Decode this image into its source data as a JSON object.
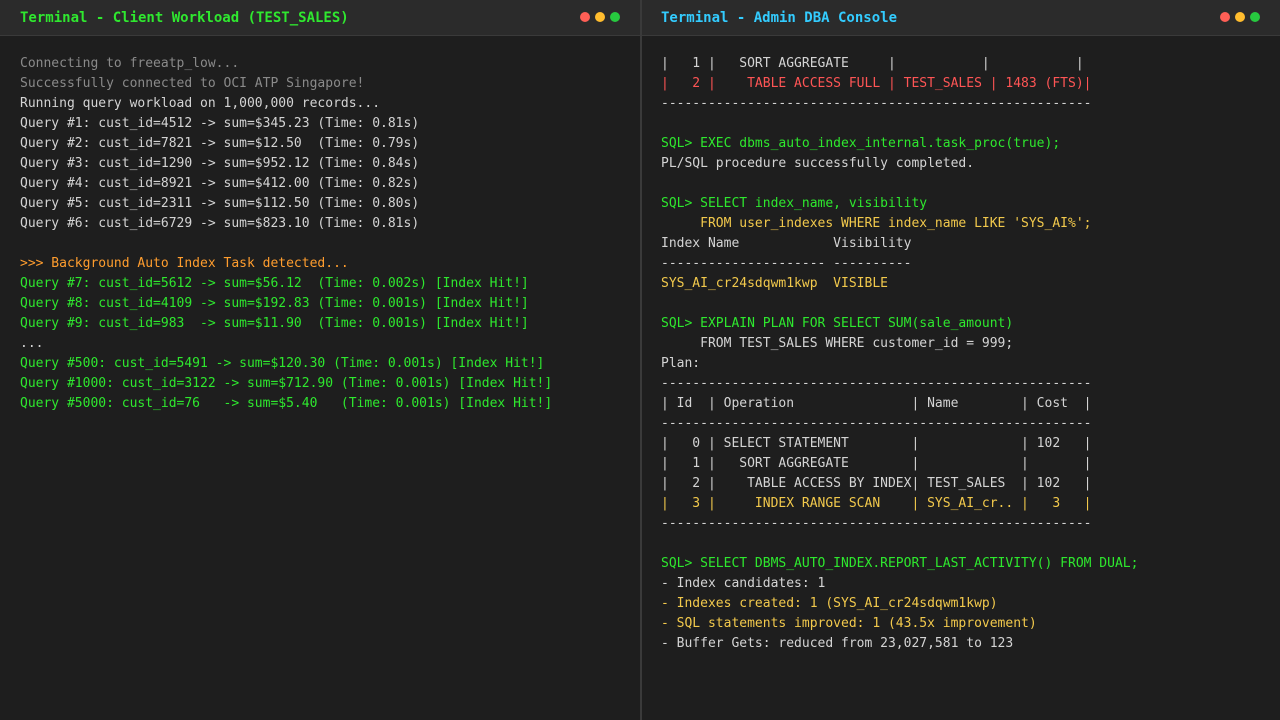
{
  "left": {
    "title": "Terminal - Client Workload (TEST_SALES)",
    "lines": [
      {
        "text": "Connecting to freeatp_low...",
        "color": "gray"
      },
      {
        "text": "Successfully connected to OCI ATP Singapore!",
        "color": "gray"
      },
      {
        "text": "Running query workload on 1,000,000 records...",
        "color": "white"
      },
      {
        "text": "Query #1: cust_id=4512 -> sum=$345.23 (Time: 0.81s)",
        "color": "white"
      },
      {
        "text": "Query #2: cust_id=7821 -> sum=$12.50  (Time: 0.79s)",
        "color": "white"
      },
      {
        "text": "Query #3: cust_id=1290 -> sum=$952.12 (Time: 0.84s)",
        "color": "white"
      },
      {
        "text": "Query #4: cust_id=8921 -> sum=$412.00 (Time: 0.82s)",
        "color": "white"
      },
      {
        "text": "Query #5: cust_id=2311 -> sum=$112.50 (Time: 0.80s)",
        "color": "white"
      },
      {
        "text": "Query #6: cust_id=6729 -> sum=$823.10 (Time: 0.81s)",
        "color": "white"
      },
      {
        "text": "",
        "color": "white"
      },
      {
        "text": ">>> Background Auto Index Task detected...",
        "color": "orange"
      },
      {
        "text": "Query #7: cust_id=5612 -> sum=$56.12  (Time: 0.002s) [Index Hit!]",
        "color": "green"
      },
      {
        "text": "Query #8: cust_id=4109 -> sum=$192.83 (Time: 0.001s) [Index Hit!]",
        "color": "green"
      },
      {
        "text": "Query #9: cust_id=983  -> sum=$11.90  (Time: 0.001s) [Index Hit!]",
        "color": "green"
      },
      {
        "text": "...",
        "color": "white"
      },
      {
        "text": "Query #500: cust_id=5491 -> sum=$120.30 (Time: 0.001s) [Index Hit!]",
        "color": "green"
      },
      {
        "text": "Query #1000: cust_id=3122 -> sum=$712.90 (Time: 0.001s) [Index Hit!]",
        "color": "green"
      },
      {
        "text": "Query #5000: cust_id=76   -> sum=$5.40   (Time: 0.001s) [Index Hit!]",
        "color": "green"
      }
    ]
  },
  "right": {
    "title": "Terminal - Admin DBA Console",
    "lines": [
      {
        "text": "|   1 |   SORT AGGREGATE     |           |           |",
        "color": "white"
      },
      {
        "text": "|   2 |    TABLE ACCESS FULL | TEST_SALES | 1483 (FTS)|",
        "color": "red"
      },
      {
        "text": "-------------------------------------------------------",
        "color": "white"
      },
      {
        "text": "",
        "color": "white"
      },
      {
        "text": "SQL> EXEC dbms_auto_index_internal.task_proc(true);",
        "color": "sqlgreen"
      },
      {
        "text": "PL/SQL procedure successfully completed.",
        "color": "white"
      },
      {
        "text": "",
        "color": "white"
      },
      {
        "text": "SQL> SELECT index_name, visibility",
        "color": "sqlgreen"
      },
      {
        "text": "     FROM user_indexes WHERE index_name LIKE 'SYS_AI%';",
        "color": "yellow"
      },
      {
        "text": "Index Name            Visibility",
        "color": "white"
      },
      {
        "text": "--------------------- ----------",
        "color": "white"
      },
      {
        "text": "SYS_AI_cr24sdqwm1kwp  VISIBLE",
        "color": "yellow"
      },
      {
        "text": "",
        "color": "white"
      },
      {
        "text": "SQL> EXPLAIN PLAN FOR SELECT SUM(sale_amount)",
        "color": "sqlgreen"
      },
      {
        "text": "     FROM TEST_SALES WHERE customer_id = 999;",
        "color": "white"
      },
      {
        "text": "Plan:",
        "color": "white"
      },
      {
        "text": "-------------------------------------------------------",
        "color": "white"
      },
      {
        "text": "| Id  | Operation               | Name        | Cost  |",
        "color": "white"
      },
      {
        "text": "-------------------------------------------------------",
        "color": "white"
      },
      {
        "text": "|   0 | SELECT STATEMENT        |             | 102   |",
        "color": "white"
      },
      {
        "text": "|   1 |   SORT AGGREGATE        |             |       |",
        "color": "white"
      },
      {
        "text": "|   2 |    TABLE ACCESS BY INDEX| TEST_SALES  | 102   |",
        "color": "white"
      },
      {
        "text": "|   3 |     INDEX RANGE SCAN    | SYS_AI_cr.. |   3   |",
        "color": "yellow"
      },
      {
        "text": "-------------------------------------------------------",
        "color": "white"
      },
      {
        "text": "",
        "color": "white"
      },
      {
        "text": "SQL> SELECT DBMS_AUTO_INDEX.REPORT_LAST_ACTIVITY() FROM DUAL;",
        "color": "sqlgreen"
      },
      {
        "text": "- Index candidates: 1",
        "color": "white"
      },
      {
        "text": "- Indexes created: 1 (SYS_AI_cr24sdqwm1kwp)",
        "color": "yellow"
      },
      {
        "text": "- SQL statements improved: 1 (43.5x improvement)",
        "color": "yellow"
      },
      {
        "text": "- Buffer Gets: reduced from 23,027,581 to 123",
        "color": "white"
      }
    ]
  }
}
